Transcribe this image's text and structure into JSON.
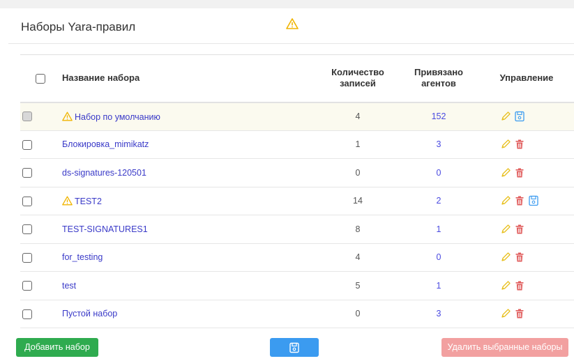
{
  "page": {
    "title": "Наборы Yara-правил"
  },
  "table": {
    "columns": {
      "name": "Название набора",
      "records": "Количество записей",
      "agents": "Привязано агентов",
      "actions": "Управление"
    },
    "rows": [
      {
        "name": "Набор по умолчанию",
        "records": "4",
        "agents": "152",
        "warning": true,
        "is_default": true,
        "actions": [
          "edit",
          "save"
        ]
      },
      {
        "name": "Блокировка_mimikatz",
        "records": "1",
        "agents": "3",
        "warning": false,
        "actions": [
          "edit",
          "delete"
        ]
      },
      {
        "name": "ds-signatures-120501",
        "records": "0",
        "agents": "0",
        "warning": false,
        "actions": [
          "edit",
          "delete"
        ]
      },
      {
        "name": "TEST2",
        "records": "14",
        "agents": "2",
        "warning": true,
        "actions": [
          "edit",
          "delete",
          "save"
        ]
      },
      {
        "name": "TEST-SIGNATURES1",
        "records": "8",
        "agents": "1",
        "warning": false,
        "actions": [
          "edit",
          "delete"
        ]
      },
      {
        "name": "for_testing",
        "records": "4",
        "agents": "0",
        "warning": false,
        "actions": [
          "edit",
          "delete"
        ]
      },
      {
        "name": "test",
        "records": "5",
        "agents": "1",
        "warning": false,
        "actions": [
          "edit",
          "delete"
        ]
      },
      {
        "name": "Пустой набор",
        "records": "0",
        "agents": "3",
        "warning": false,
        "actions": [
          "edit",
          "delete"
        ]
      }
    ]
  },
  "buttons": {
    "add": "Добавить набор",
    "delete_selected": "Удалить выбранные наборы"
  },
  "colors": {
    "add_button": "#2fab4f",
    "save_button": "#3b9bf0",
    "delete_button": "#f2a0a0",
    "warning": "#f0b400",
    "edit_icon": "#e8c020",
    "delete_icon": "#e05a5a",
    "save_icon": "#3b9bf0"
  },
  "icons": {
    "warning": "warning-icon",
    "edit": "pencil-icon",
    "delete": "trash-icon",
    "save": "floppy-disk-icon"
  }
}
